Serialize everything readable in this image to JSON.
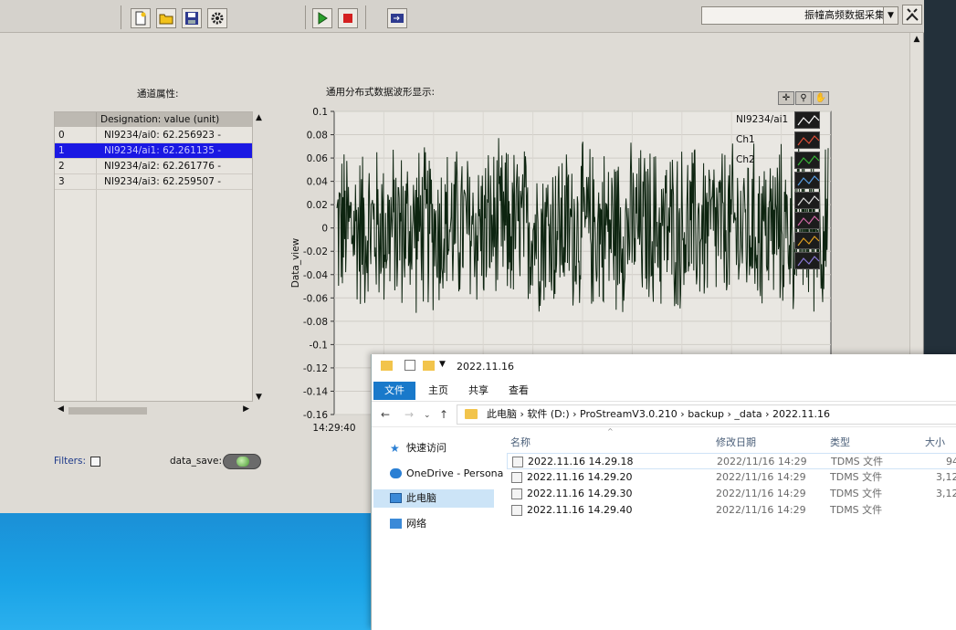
{
  "window": {
    "combo_value": "振幢高频数据采集"
  },
  "toolbar": {
    "icons": [
      "new-file-icon",
      "open-folder-icon",
      "save-icon",
      "settings-gear-icon",
      "run-icon",
      "stop-icon",
      "config-icon",
      "tools-icon"
    ]
  },
  "panel": {
    "channel_caption": "通道属性:",
    "graph_caption": "通用分布式数据波形显示:",
    "table_header": "Designation:  value  (unit)",
    "rows": [
      {
        "index": "0",
        "text": "NI9234/ai0:   62.256923 -"
      },
      {
        "index": "1",
        "text": "NI9234/ai1:   62.261135 -"
      },
      {
        "index": "2",
        "text": "NI9234/ai2:   62.261776 -"
      },
      {
        "index": "3",
        "text": "NI9234/ai3:   62.259507 -"
      }
    ],
    "filters_label": "Filters:",
    "data_save_label": "data_save:"
  },
  "chart_data": {
    "type": "line",
    "ylabel": "Data_view",
    "ylim": [
      -0.16,
      0.1
    ],
    "yticks": [
      "0.1",
      "0.08",
      "0.06",
      "0.04",
      "0.02",
      "0",
      "-0.02",
      "-0.04",
      "-0.06",
      "-0.08",
      "-0.1",
      "-0.12",
      "-0.14",
      "-0.16"
    ],
    "xtick": "14:29:40",
    "grid": true,
    "series": [
      {
        "name": "NI9234/ai1",
        "color": "#0d2410",
        "amplitude": 0.08
      }
    ],
    "legend": [
      {
        "name": "NI9234/ai1",
        "color": "#ffffff"
      },
      {
        "name": "Ch1",
        "color": "#e0503a"
      },
      {
        "name": "Ch2",
        "color": "#3ab83a"
      },
      {
        "name": "",
        "color": "#5aa0e6"
      },
      {
        "name": "",
        "color": "#e0e0e0"
      },
      {
        "name": "",
        "color": "#d36aa8"
      },
      {
        "name": "",
        "color": "#e0a020"
      },
      {
        "name": "",
        "color": "#8a7ad8"
      }
    ]
  },
  "explorer": {
    "title": "2022.11.16",
    "ribbon_tabs": [
      "文件",
      "主页",
      "共享",
      "查看"
    ],
    "breadcrumb": "此电脑  ›  软件 (D:)  ›  ProStreamV3.0.210  ›  backup  ›  _data  ›  2022.11.16",
    "nav": [
      "快速访问",
      "OneDrive - Persona",
      "此电脑",
      "网络"
    ],
    "columns": [
      "名称",
      "修改日期",
      "类型",
      "大小"
    ],
    "files": [
      {
        "name": "2022.11.16 14.29.18",
        "date": "2022/11/16 14:29",
        "type": "TDMS 文件",
        "size": "94"
      },
      {
        "name": "2022.11.16 14.29.20",
        "date": "2022/11/16 14:29",
        "type": "TDMS 文件",
        "size": "3,12"
      },
      {
        "name": "2022.11.16 14.29.30",
        "date": "2022/11/16 14:29",
        "type": "TDMS 文件",
        "size": "3,12"
      },
      {
        "name": "2022.11.16 14.29.40",
        "date": "2022/11/16 14:29",
        "type": "TDMS 文件",
        "size": ""
      }
    ]
  }
}
